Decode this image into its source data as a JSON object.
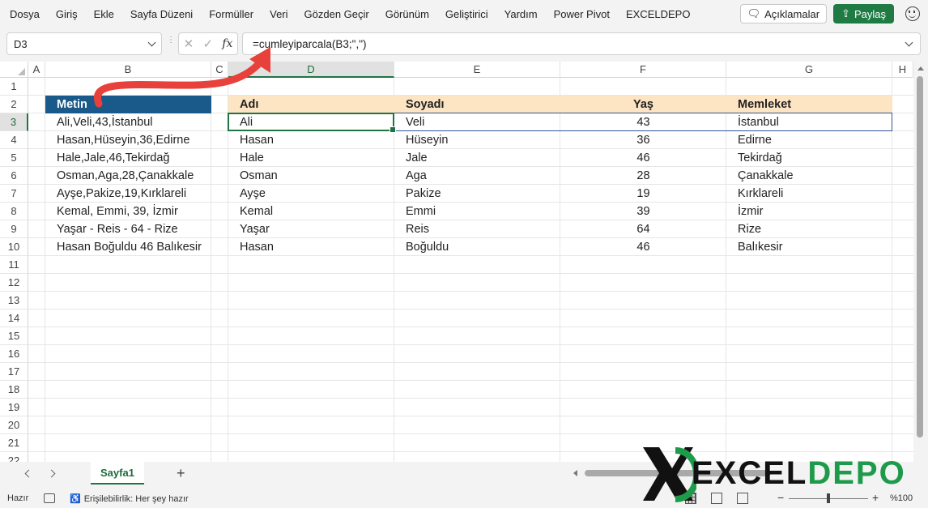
{
  "menu": [
    "Dosya",
    "Giriş",
    "Ekle",
    "Sayfa Düzeni",
    "Formüller",
    "Veri",
    "Gözden Geçir",
    "Görünüm",
    "Geliştirici",
    "Yardım",
    "Power Pivot",
    "EXCELDEPO"
  ],
  "comments_label": "Açıklamalar",
  "share_label": "Paylaş",
  "name_box": "D3",
  "formula": "=cumleyiparcala(B3;\",\")",
  "fx_label": "fx",
  "columns": [
    "A",
    "B",
    "C",
    "D",
    "E",
    "F",
    "G",
    "H"
  ],
  "rows": [
    "1",
    "2",
    "3",
    "4",
    "5",
    "6",
    "7",
    "8",
    "9",
    "10",
    "11",
    "12",
    "13",
    "14",
    "15",
    "16",
    "17",
    "18",
    "19",
    "20",
    "21",
    "22"
  ],
  "source": {
    "header": "Metin",
    "items": [
      "Ali,Veli,43,İstanbul",
      "Hasan,Hüseyin,36,Edirne",
      "Hale,Jale,46,Tekirdağ",
      "Osman,Aga,28,Çanakkale",
      "Ayşe,Pakize,19,Kırklareli",
      "Kemal, Emmi, 39, İzmir",
      "Yaşar - Reis - 64 - Rize",
      "Hasan Boğuldu 46 Balıkesir"
    ]
  },
  "result": {
    "headers": [
      "Adı",
      "Soyadı",
      "Yaş",
      "Memleket"
    ],
    "rows": [
      [
        "Ali",
        "Veli",
        "43",
        "İstanbul"
      ],
      [
        "Hasan",
        "Hüseyin",
        "36",
        "Edirne"
      ],
      [
        "Hale",
        "Jale",
        "46",
        "Tekirdağ"
      ],
      [
        "Osman",
        "Aga",
        "28",
        "Çanakkale"
      ],
      [
        "Ayşe",
        "Pakize",
        "19",
        "Kırklareli"
      ],
      [
        "Kemal",
        "Emmi",
        "39",
        "İzmir"
      ],
      [
        "Yaşar",
        "Reis",
        "64",
        "Rize"
      ],
      [
        "Hasan",
        "Boğuldu",
        "46",
        "Balıkesir"
      ]
    ]
  },
  "sheet_tab": "Sayfa1",
  "add_sheet": "+",
  "status": {
    "ready": "Hazır",
    "accessibility": "Erişilebilirlik: Her şey hazır",
    "zoom": "%100",
    "zoom_minus": "−",
    "zoom_plus": "+"
  },
  "logo": {
    "part1": "EXCEL",
    "part2": "DEPO"
  },
  "colors": {
    "metin_header_bg": "#1a5a8a",
    "result_header_bg": "#fde4c2",
    "selection": "#217346",
    "arrow": "#e8403a",
    "share_button": "#1f7a44"
  }
}
